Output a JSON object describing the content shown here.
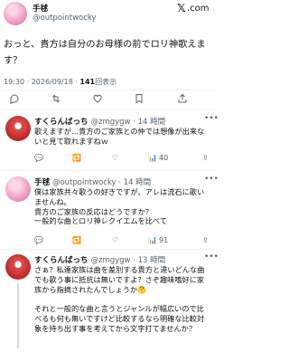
{
  "header": {
    "name": "手毬",
    "handle": "@outpointwocky",
    "brand": "𝕏",
    "brand_suffix": ".com"
  },
  "tweet": {
    "text": "おっと、貴方は自分のお母様の前でロリ神歌えます？",
    "time": "19:30 · 2026/09/18 · ",
    "views_count": "141",
    "views_label": "回表示"
  },
  "toolbar": {
    "icons": [
      "reply-icon",
      "retweet-icon",
      "like-icon",
      "bookmark-icon",
      "share-icon"
    ]
  },
  "replies": [
    {
      "name": "すくらんばっち",
      "handle": "@zmgygw · 14 時間",
      "text": "歌えますが…貴方のご家族との仲では想像が出来ないと見て取れますねｗ",
      "count": "40"
    },
    {
      "name": "手毬",
      "handle": "@outpointwocky · 14 時間",
      "text": "僕は家族共々歌うの好きですが、アレは流石に歌いませんね。\n貴方のご家族の反応はどうですか？\n一般的な曲とロリ神レクイエムを比べて",
      "count": "91"
    },
    {
      "name": "すくらんばっち",
      "handle": "@zmgygw · 13 時間",
      "text": "さぁ？私達家族は曲を差別する貴方と違いどんな曲でも歌う事に抵抗は無いですよ？さぞ趣味嗜好に家族から指摘されたんでしょうか🤔\n\nそれと一般的な曲と言うとジャンルが幅広いので比べるも何も無いですけど比較するなら明確な比較対象を持ち出す事を考えてから文字打てませんか？",
      "count": ""
    }
  ],
  "icons": {
    "more": "more-icon",
    "x": "x-logo-icon"
  },
  "colors": {
    "text": "#0f1419",
    "muted": "#536471",
    "divider": "#eff3f4"
  }
}
